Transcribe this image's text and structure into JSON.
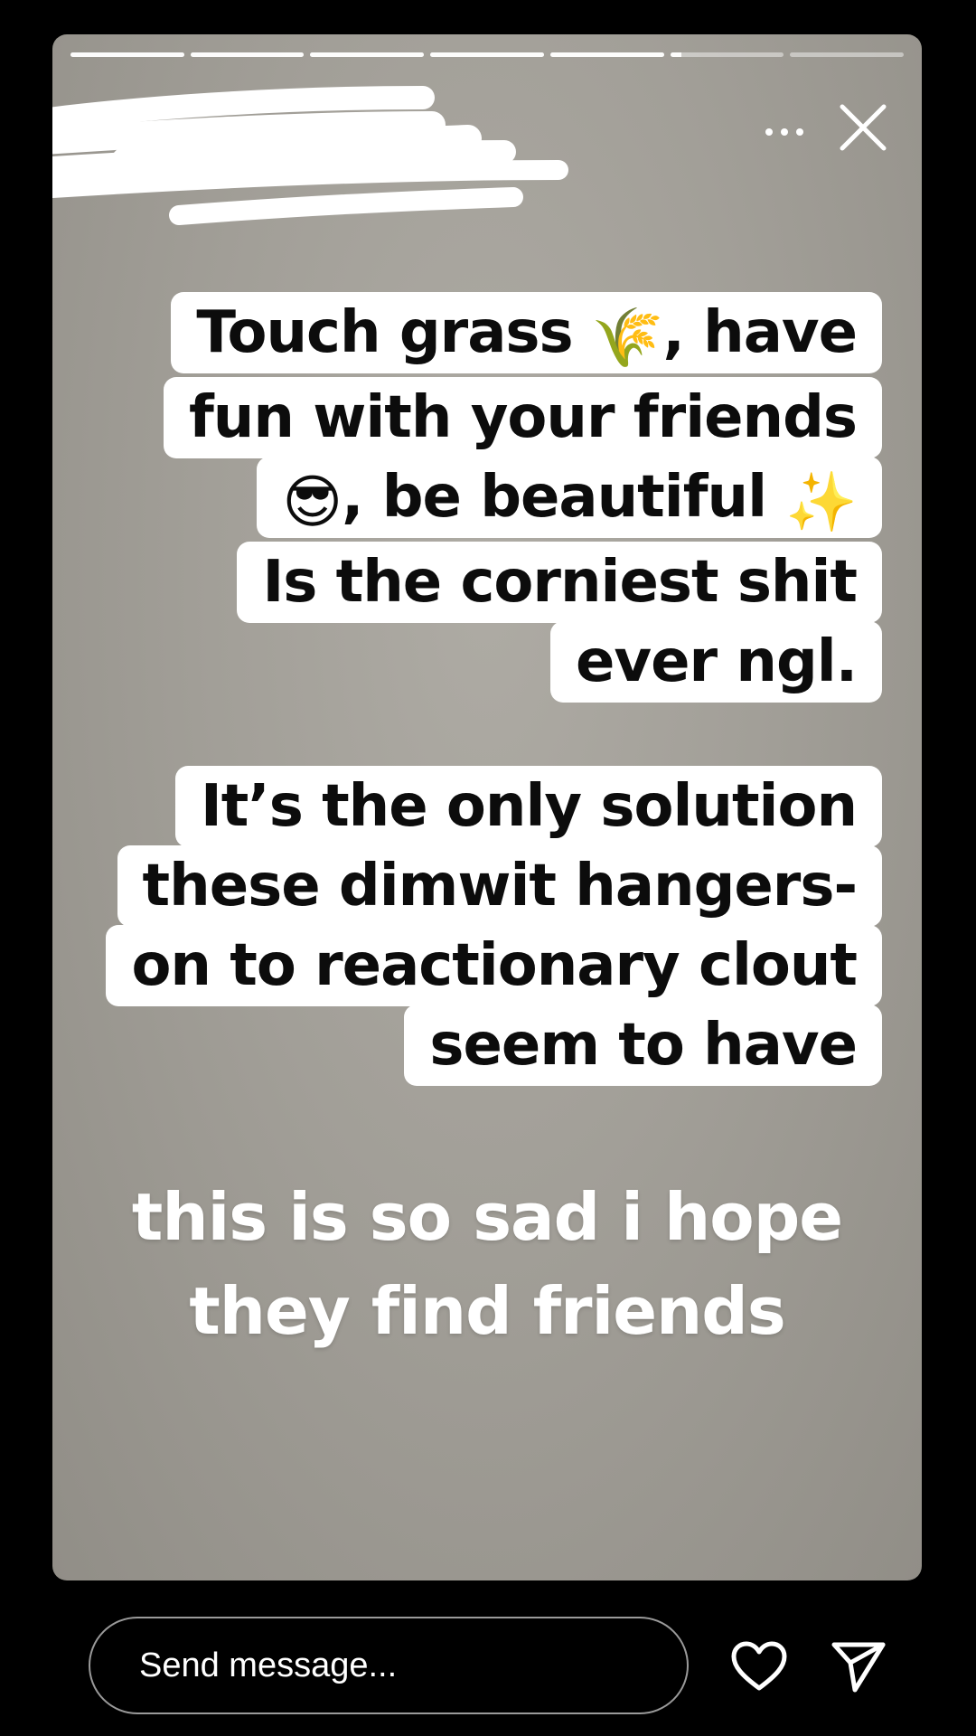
{
  "story": {
    "progress_segments": [
      1,
      1,
      1,
      1,
      1,
      0.1,
      0
    ],
    "more_icon": "more-horizontal-icon",
    "close_icon": "close-icon",
    "username_redacted": true
  },
  "block1": {
    "line1_a": "Touch grass ",
    "emoji_grass": "🌾",
    "line1_b": ", have",
    "line2": "fun with your friends",
    "emoji_sunglasses": "😎",
    "line3_b": ", be beautiful ",
    "emoji_sparkles": "✨",
    "line4": "Is the corniest shit",
    "line5": "ever ngl."
  },
  "block2": {
    "line1": "It’s the only solution",
    "line2": "these dimwit hangers-",
    "line3": "on to reactionary clout",
    "line4": "seem to have"
  },
  "caption": {
    "line1": "this is so sad i hope",
    "line2": "they find friends"
  },
  "footer": {
    "message_placeholder": "Send message...",
    "heart_icon": "heart-icon",
    "send_icon": "send-icon"
  },
  "colors": {
    "background": "#000000",
    "story_bg": "#a29f98",
    "text_box": "#ffffff",
    "caption_text": "#ffffff"
  }
}
